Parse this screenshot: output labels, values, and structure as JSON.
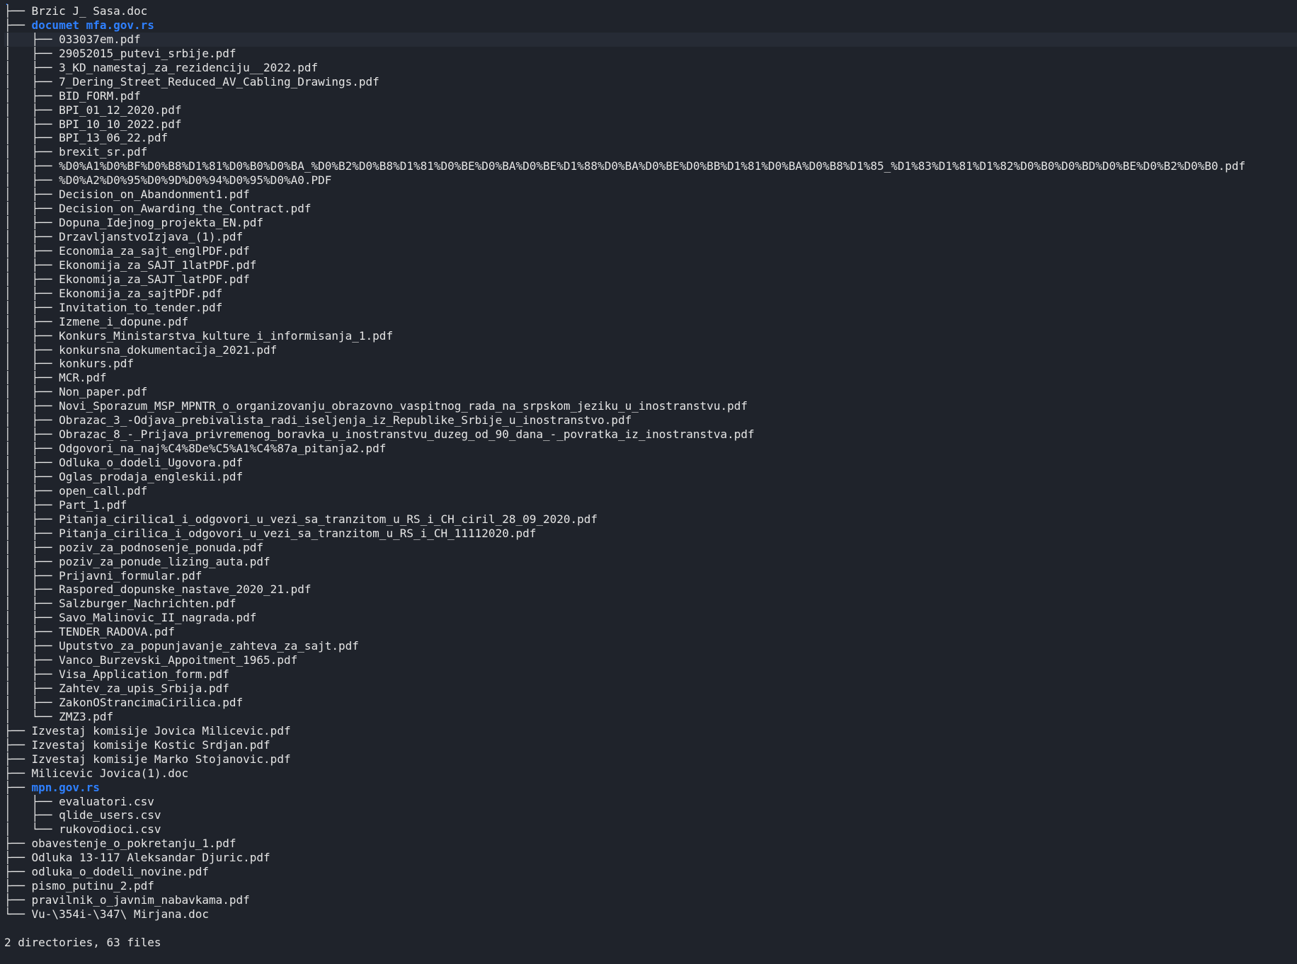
{
  "colors": {
    "background": "#1f232b",
    "text": "#e6e6e6",
    "directory": "#2f80ff"
  },
  "root": ".",
  "tree": [
    {
      "prefix": "├── ",
      "name": "Brzic J_ Sasa.doc",
      "dir": false
    },
    {
      "prefix": "├── ",
      "name": "documet mfa.gov.rs",
      "dir": true
    },
    {
      "prefix": "│   ├── ",
      "name": "033037em.pdf",
      "dir": false,
      "highlight": true
    },
    {
      "prefix": "│   ├── ",
      "name": "29052015_putevi_srbije.pdf",
      "dir": false
    },
    {
      "prefix": "│   ├── ",
      "name": "3_KD_namestaj_za_rezidenciju__2022.pdf",
      "dir": false
    },
    {
      "prefix": "│   ├── ",
      "name": "7_Dering_Street_Reduced_AV_Cabling_Drawings.pdf",
      "dir": false
    },
    {
      "prefix": "│   ├── ",
      "name": "BID_FORM.pdf",
      "dir": false
    },
    {
      "prefix": "│   ├── ",
      "name": "BPI_01_12_2020.pdf",
      "dir": false
    },
    {
      "prefix": "│   ├── ",
      "name": "BPI_10_10_2022.pdf",
      "dir": false
    },
    {
      "prefix": "│   ├── ",
      "name": "BPI_13_06_22.pdf",
      "dir": false
    },
    {
      "prefix": "│   ├── ",
      "name": "brexit_sr.pdf",
      "dir": false
    },
    {
      "prefix": "│   ├── ",
      "name": "%D0%A1%D0%BF%D0%B8%D1%81%D0%B0%D0%BA_%D0%B2%D0%B8%D1%81%D0%BE%D0%BA%D0%BE%D1%88%D0%BA%D0%BE%D0%BB%D1%81%D0%BA%D0%B8%D1%85_%D1%83%D1%81%D1%82%D0%B0%D0%BD%D0%BE%D0%B2%D0%B0.pdf",
      "dir": false
    },
    {
      "prefix": "│   ├── ",
      "name": "%D0%A2%D0%95%D0%9D%D0%94%D0%95%D0%A0.PDF",
      "dir": false
    },
    {
      "prefix": "│   ├── ",
      "name": "Decision_on_Abandonment1.pdf",
      "dir": false
    },
    {
      "prefix": "│   ├── ",
      "name": "Decision_on_Awarding_the_Contract.pdf",
      "dir": false
    },
    {
      "prefix": "│   ├── ",
      "name": "Dopuna_Idejnog_projekta_EN.pdf",
      "dir": false
    },
    {
      "prefix": "│   ├── ",
      "name": "DrzavljanstvoIzjava_(1).pdf",
      "dir": false
    },
    {
      "prefix": "│   ├── ",
      "name": "Economia_za_sajt_englPDF.pdf",
      "dir": false
    },
    {
      "prefix": "│   ├── ",
      "name": "Ekonomija_za_SAJT_1latPDF.pdf",
      "dir": false
    },
    {
      "prefix": "│   ├── ",
      "name": "Ekonomija_za_SAJT_latPDF.pdf",
      "dir": false
    },
    {
      "prefix": "│   ├── ",
      "name": "Ekonomija_za_sajtPDF.pdf",
      "dir": false
    },
    {
      "prefix": "│   ├── ",
      "name": "Invitation_to_tender.pdf",
      "dir": false
    },
    {
      "prefix": "│   ├── ",
      "name": "Izmene_i_dopune.pdf",
      "dir": false
    },
    {
      "prefix": "│   ├── ",
      "name": "Konkurs_Ministarstva_kulture_i_informisanja_1.pdf",
      "dir": false
    },
    {
      "prefix": "│   ├── ",
      "name": "konkursna_dokumentacija_2021.pdf",
      "dir": false
    },
    {
      "prefix": "│   ├── ",
      "name": "konkurs.pdf",
      "dir": false
    },
    {
      "prefix": "│   ├── ",
      "name": "MCR.pdf",
      "dir": false
    },
    {
      "prefix": "│   ├── ",
      "name": "Non_paper.pdf",
      "dir": false
    },
    {
      "prefix": "│   ├── ",
      "name": "Novi_Sporazum_MSP_MPNTR_o_organizovanju_obrazovno_vaspitnog_rada_na_srpskom_jeziku_u_inostranstvu.pdf",
      "dir": false
    },
    {
      "prefix": "│   ├── ",
      "name": "Obrazac_3_-Odjava_prebivalista_radi_iseljenja_iz_Republike_Srbije_u_inostranstvo.pdf",
      "dir": false
    },
    {
      "prefix": "│   ├── ",
      "name": "Obrazac_8_-_Prijava_privremenog_boravka_u_inostranstvu_duzeg_od_90_dana_-_povratka_iz_inostranstva.pdf",
      "dir": false
    },
    {
      "prefix": "│   ├── ",
      "name": "Odgovori_na_naj%C4%8De%C5%A1%C4%87a_pitanja2.pdf",
      "dir": false
    },
    {
      "prefix": "│   ├── ",
      "name": "Odluka_o_dodeli_Ugovora.pdf",
      "dir": false
    },
    {
      "prefix": "│   ├── ",
      "name": "Oglas_prodaja_engleskii.pdf",
      "dir": false
    },
    {
      "prefix": "│   ├── ",
      "name": "open_call.pdf",
      "dir": false
    },
    {
      "prefix": "│   ├── ",
      "name": "Part_1.pdf",
      "dir": false
    },
    {
      "prefix": "│   ├── ",
      "name": "Pitanja_cirilica1_i_odgovori_u_vezi_sa_tranzitom_u_RS_i_CH_ciril_28_09_2020.pdf",
      "dir": false
    },
    {
      "prefix": "│   ├── ",
      "name": "Pitanja_cirilica_i_odgovori_u_vezi_sa_tranzitom_u_RS_i_CH_11112020.pdf",
      "dir": false
    },
    {
      "prefix": "│   ├── ",
      "name": "poziv_za_podnosenje_ponuda.pdf",
      "dir": false
    },
    {
      "prefix": "│   ├── ",
      "name": "poziv_za_ponude_lizing_auta.pdf",
      "dir": false
    },
    {
      "prefix": "│   ├── ",
      "name": "Prijavni_formular.pdf",
      "dir": false
    },
    {
      "prefix": "│   ├── ",
      "name": "Raspored_dopunske_nastave_2020_21.pdf",
      "dir": false
    },
    {
      "prefix": "│   ├── ",
      "name": "Salzburger_Nachrichten.pdf",
      "dir": false
    },
    {
      "prefix": "│   ├── ",
      "name": "Savo_Malinovic_II_nagrada.pdf",
      "dir": false
    },
    {
      "prefix": "│   ├── ",
      "name": "TENDER_RADOVA.pdf",
      "dir": false
    },
    {
      "prefix": "│   ├── ",
      "name": "Uputstvo_za_popunjavanje_zahteva_za_sajt.pdf",
      "dir": false
    },
    {
      "prefix": "│   ├── ",
      "name": "Vanco_Burzevski_Appoitment_1965.pdf",
      "dir": false
    },
    {
      "prefix": "│   ├── ",
      "name": "Visa_Application_form.pdf",
      "dir": false
    },
    {
      "prefix": "│   ├── ",
      "name": "Zahtev_za_upis_Srbija.pdf",
      "dir": false
    },
    {
      "prefix": "│   ├── ",
      "name": "ZakonOStrancimaCirilica.pdf",
      "dir": false
    },
    {
      "prefix": "│   └── ",
      "name": "ZMZ3.pdf",
      "dir": false
    },
    {
      "prefix": "├── ",
      "name": "Izvestaj komisije Jovica Milicevic.pdf",
      "dir": false
    },
    {
      "prefix": "├── ",
      "name": "Izvestaj komisije Kostic Srdjan.pdf",
      "dir": false
    },
    {
      "prefix": "├── ",
      "name": "Izvestaj komisije Marko Stojanovic.pdf",
      "dir": false
    },
    {
      "prefix": "├── ",
      "name": "Milicevic Jovica(1).doc",
      "dir": false
    },
    {
      "prefix": "├── ",
      "name": "mpn.gov.rs",
      "dir": true
    },
    {
      "prefix": "│   ├── ",
      "name": "evaluatori.csv",
      "dir": false
    },
    {
      "prefix": "│   ├── ",
      "name": "qlide_users.csv",
      "dir": false
    },
    {
      "prefix": "│   └── ",
      "name": "rukovodioci.csv",
      "dir": false
    },
    {
      "prefix": "├── ",
      "name": "obavestenje_o_pokretanju_1.pdf",
      "dir": false
    },
    {
      "prefix": "├── ",
      "name": "Odluka 13-117 Aleksandar Djuric.pdf",
      "dir": false
    },
    {
      "prefix": "├── ",
      "name": "odluka_o_dodeli_novine.pdf",
      "dir": false
    },
    {
      "prefix": "├── ",
      "name": "pismo_putinu_2.pdf",
      "dir": false
    },
    {
      "prefix": "├── ",
      "name": "pravilnik_o_javnim_nabavkama.pdf",
      "dir": false
    },
    {
      "prefix": "└── ",
      "name": "Vu-\\354i-\\347\\ Mirjana.doc",
      "dir": false
    }
  ],
  "summary": "2 directories, 63 files"
}
